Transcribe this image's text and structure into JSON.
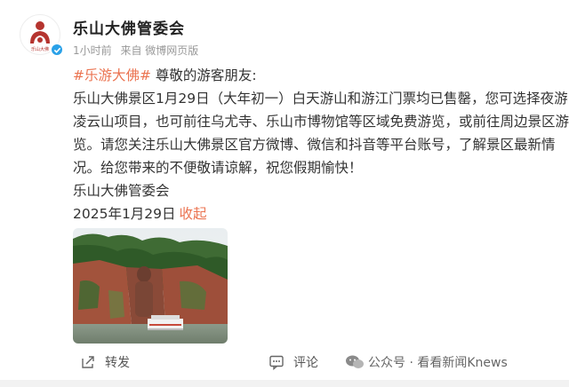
{
  "post": {
    "author": "乐山大佛管委会",
    "time": "1小时前",
    "source": "来自 微博网页版",
    "tag": "#乐游大佛#",
    "greeting": " 尊敬的游客朋友:",
    "body_lines": [
      "乐山大佛景区1月29日（大年初一）白天游山和游江门票均已售罄，您可选择夜游",
      "凌云山项目，也可前往乌尤寺、乐山市博物馆等区域免费游览，或前往周边景区游",
      "览。请您关注乐山大佛景区官方微博、微信和抖音等平台账号，了解景区最新情",
      "况。给您带来的不便敬请谅解，祝您假期愉快！"
    ],
    "signature": "乐山大佛管委会",
    "date": "2025年1月29日",
    "collapse": "收起"
  },
  "actions": {
    "repost": "转发",
    "comment": "评论"
  },
  "watermark": {
    "text": "公众号 · 看看新闻Knews"
  },
  "colors": {
    "accent": "#eb7350",
    "verified": "#2aa1e8",
    "logo": "#b5342f"
  }
}
